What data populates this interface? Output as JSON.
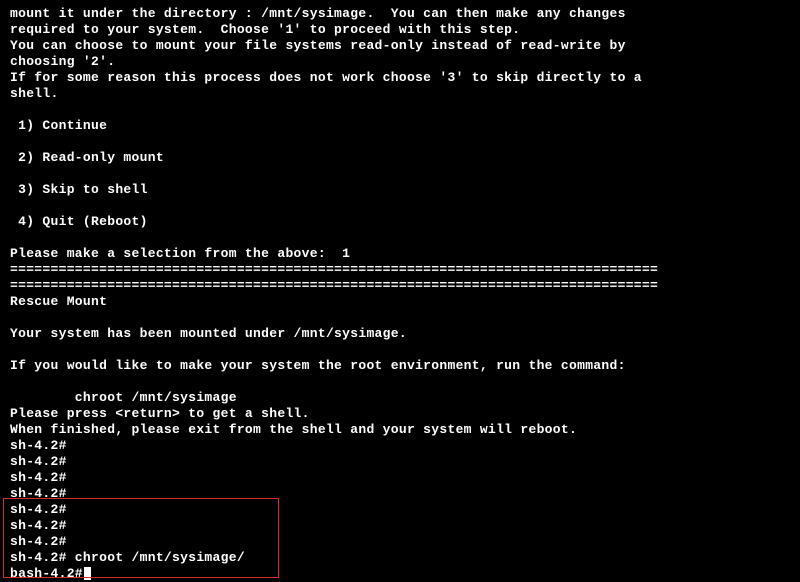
{
  "lines": [
    "mount it under the directory : /mnt/sysimage.  You can then make any changes",
    "required to your system.  Choose '1' to proceed with this step.",
    "You can choose to mount your file systems read-only instead of read-write by",
    "choosing '2'.",
    "If for some reason this process does not work choose '3' to skip directly to a",
    "shell.",
    "",
    " 1) Continue",
    "",
    " 2) Read-only mount",
    "",
    " 3) Skip to shell",
    "",
    " 4) Quit (Reboot)",
    "",
    "Please make a selection from the above:  1",
    "================================================================================",
    "================================================================================",
    "Rescue Mount",
    "",
    "Your system has been mounted under /mnt/sysimage.",
    "",
    "If you would like to make your system the root environment, run the command:",
    "",
    "        chroot /mnt/sysimage",
    "Please press <return> to get a shell.",
    "When finished, please exit from the shell and your system will reboot.",
    "sh-4.2#",
    "sh-4.2#",
    "sh-4.2#",
    "sh-4.2#",
    "sh-4.2#",
    "sh-4.2#",
    "sh-4.2#",
    "sh-4.2# chroot /mnt/sysimage/",
    "bash-4.2#"
  ]
}
